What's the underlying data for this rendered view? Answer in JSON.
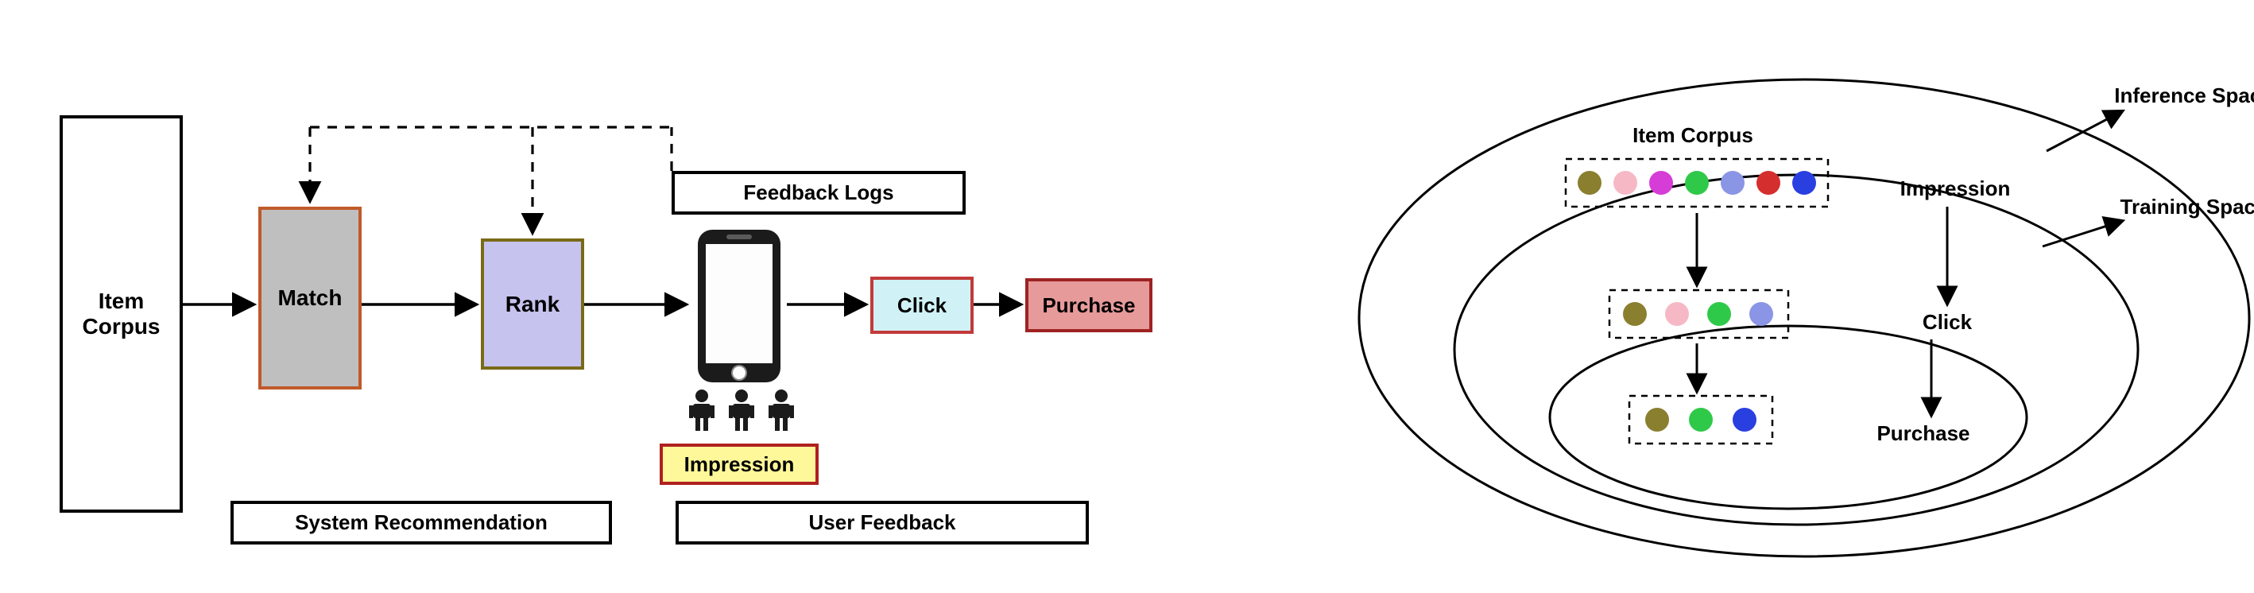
{
  "left": {
    "item_corpus": "Item\nCorpus",
    "match": "Match",
    "rank": "Rank",
    "feedback_logs": "Feedback Logs",
    "impression": "Impression",
    "click": "Click",
    "purchase": "Purchase",
    "system_recommendation": "System Recommendation",
    "user_feedback": "User Feedback"
  },
  "right": {
    "item_corpus": "Item Corpus",
    "impression": "Impression",
    "click": "Click",
    "purchase": "Purchase",
    "inference_space": "Inference Space",
    "training_space": "Training Space",
    "dots": {
      "row1_colors": [
        "#8a7f2f",
        "#f7b8c6",
        "#d63cd6",
        "#2fc94a",
        "#8b95e6",
        "#d42e2e",
        "#2a3fe0"
      ],
      "row2_colors": [
        "#8a7f2f",
        "#f7b8c6",
        "#2fc94a",
        "#8b95e6"
      ],
      "row3_colors": [
        "#8a7f2f",
        "#2fc94a",
        "#2a3fe0"
      ]
    }
  }
}
